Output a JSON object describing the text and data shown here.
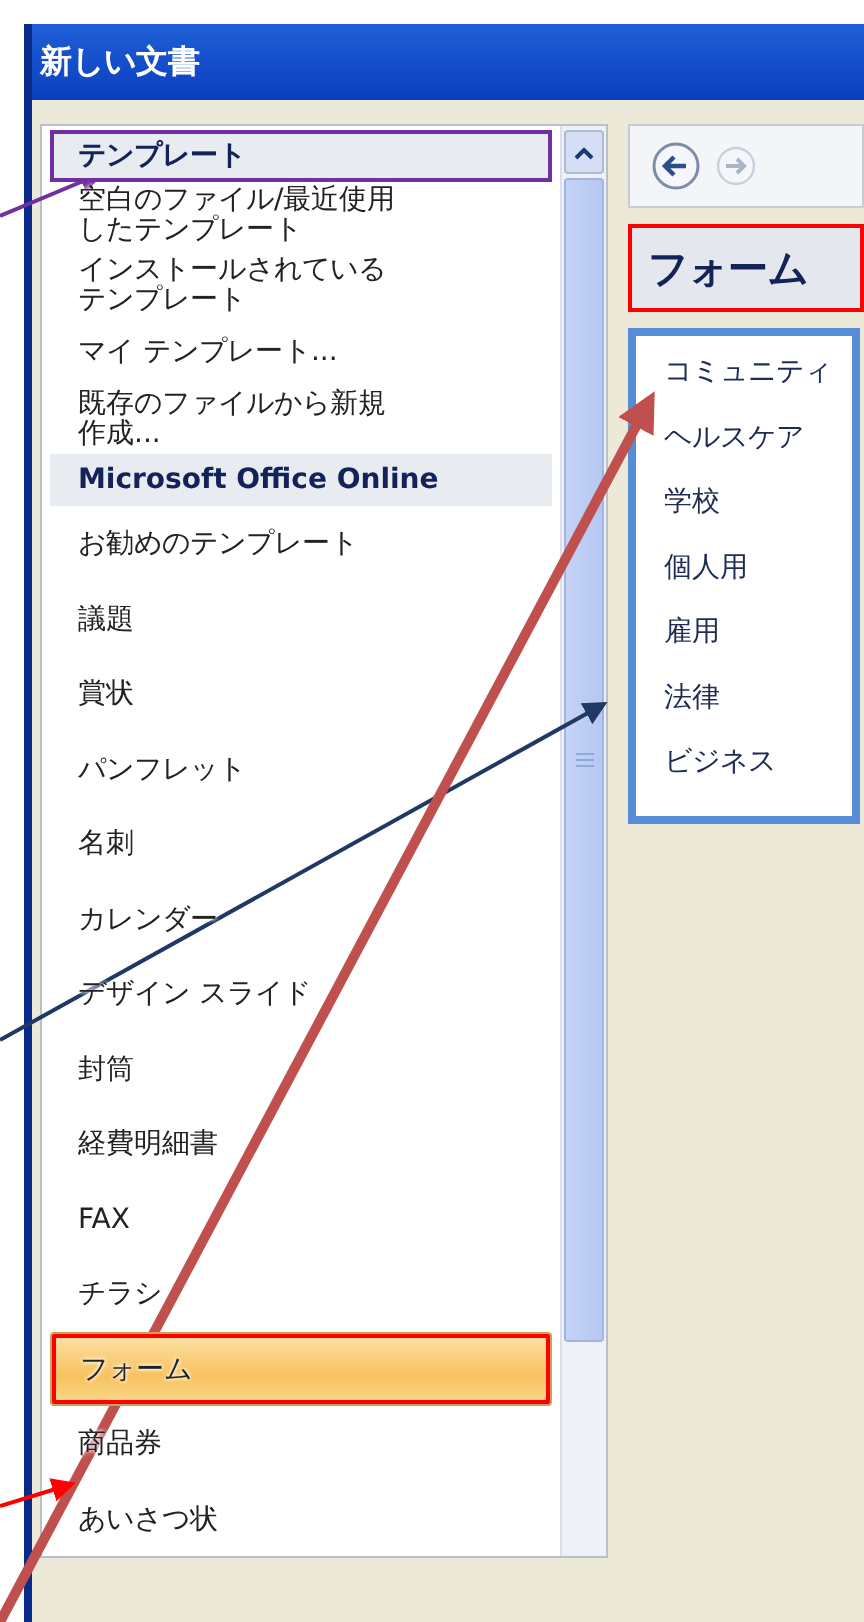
{
  "window": {
    "title": "新しい文書"
  },
  "sidebar": {
    "items": [
      {
        "kind": "header",
        "label": "テンプレート",
        "boxed": true
      },
      {
        "kind": "item",
        "label": "空白のファイル/最近使用したテンプレート",
        "selected": false
      },
      {
        "kind": "item",
        "label": "インストールされているテンプレート",
        "selected": false
      },
      {
        "kind": "item",
        "label": "マイ テンプレート...",
        "selected": false
      },
      {
        "kind": "item",
        "label": "既存のファイルから新規作成...",
        "selected": false
      },
      {
        "kind": "header",
        "label": "Microsoft Office Online",
        "boxed": false
      },
      {
        "kind": "item",
        "label": "お勧めのテンプレート",
        "selected": false
      },
      {
        "kind": "item",
        "label": "議題",
        "selected": false
      },
      {
        "kind": "item",
        "label": "賞状",
        "selected": false
      },
      {
        "kind": "item",
        "label": "パンフレット",
        "selected": false
      },
      {
        "kind": "item",
        "label": "名刺",
        "selected": false
      },
      {
        "kind": "item",
        "label": "カレンダー",
        "selected": false
      },
      {
        "kind": "item",
        "label": "デザイン スライド",
        "selected": false
      },
      {
        "kind": "item",
        "label": "封筒",
        "selected": false
      },
      {
        "kind": "item",
        "label": "経費明細書",
        "selected": false
      },
      {
        "kind": "item",
        "label": "FAX",
        "selected": false
      },
      {
        "kind": "item",
        "label": "チラシ",
        "selected": false
      },
      {
        "kind": "item",
        "label": "フォーム",
        "selected": true,
        "boxed": true
      },
      {
        "kind": "item",
        "label": "商品券",
        "selected": false
      },
      {
        "kind": "item",
        "label": "あいさつ状",
        "selected": false
      }
    ]
  },
  "content": {
    "heading": "フォーム",
    "heading_boxed": true,
    "list_boxed": true,
    "categories": [
      "コミュニティ",
      "ヘルスケア",
      "学校",
      "個人用",
      "雇用",
      "法律",
      "ビジネス"
    ]
  }
}
